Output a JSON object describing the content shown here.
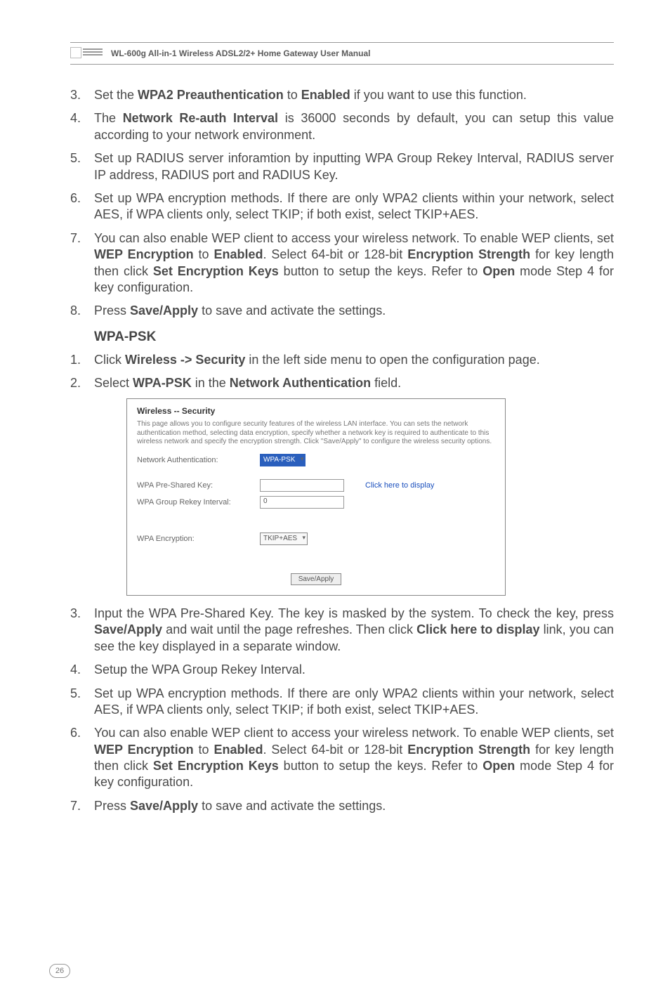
{
  "header": {
    "title": "WL-600g All-in-1 Wireless ADSL2/2+ Home Gateway User Manual"
  },
  "list1": {
    "i3": "Set the <b>WPA2 Preauthentication</b> to <b>Enabled</b> if you want to use this function.",
    "i4": "The <b>Network Re-auth Interval</b> is 36000 seconds by default, you can setup this value according to your network environment.",
    "i5": "Set up RADIUS server inforamtion by inputting WPA Group Rekey Interval, RADIUS server IP address, RADIUS port and RADIUS Key.",
    "i6": "Set up WPA encryption methods. If there are only WPA2 clients within your network, select AES, if WPA clients only, select TKIP; if both exist, select TKIP+AES.",
    "i7": "You can also enable WEP client to access your wireless network. To enable WEP clients, set <b>WEP Encryption</b> to <b>Enabled</b>. Select 64-bit or 128-bit <b>Encryption Strength</b> for key length then click <b>Set Encryption Keys</b> button to setup the keys. Refer to <b>Open</b> mode Step 4 for key configuration.",
    "i8": "Press <b>Save/Apply</b> to save and activate the settings."
  },
  "section_heading": "WPA-PSK",
  "list2": {
    "i1": "Click <b>Wireless -> Security</b> in the left side menu to open the configuration page.",
    "i2": "Select <b>WPA-PSK</b> in the <b>Network Authentication</b> field."
  },
  "screenshot": {
    "title": "Wireless -- Security",
    "desc": "This page allows you to configure security features of the wireless LAN interface. You can sets the network authentication method, selecting data encryption, specify whether a network key is required to authenticate to this wireless network and specify the encryption strength.\nClick \"Save/Apply\" to configure the wireless security options.",
    "row_auth_label": "Network Authentication:",
    "row_auth_value": "WPA-PSK",
    "row_psk_label": "WPA Pre-Shared Key:",
    "row_psk_link": "Click here to display",
    "row_rekey_label": "WPA Group Rekey Interval:",
    "row_rekey_value": "0",
    "row_enc_label": "WPA Encryption:",
    "row_enc_value": "TKIP+AES",
    "btn": "Save/Apply"
  },
  "list3": {
    "i3": "Input the WPA Pre-Shared Key. The key is masked by the system. To check the key, press <b>Save/Apply</b> and wait until the page refreshes. Then click <b>Click here to display</b> link, you can see the key displayed in a separate window.",
    "i4": "Setup the WPA Group Rekey Interval.",
    "i5": "Set up WPA encryption methods. If there are only WPA2 clients within your network, select AES, if WPA clients only, select TKIP; if both exist, select TKIP+AES.",
    "i6": "You can also enable WEP client to access your wireless network. To enable WEP clients, set <b>WEP Encryption</b> to <b>Enabled</b>. Select 64-bit or 128-bit <b>Encryption Strength</b> for key length then click <b>Set Encryption Keys</b> button to setup the keys. Refer to <b>Open</b> mode Step 4 for key configuration.",
    "i7": "Press <b>Save/Apply</b> to save and activate the settings."
  },
  "page_number": "26"
}
